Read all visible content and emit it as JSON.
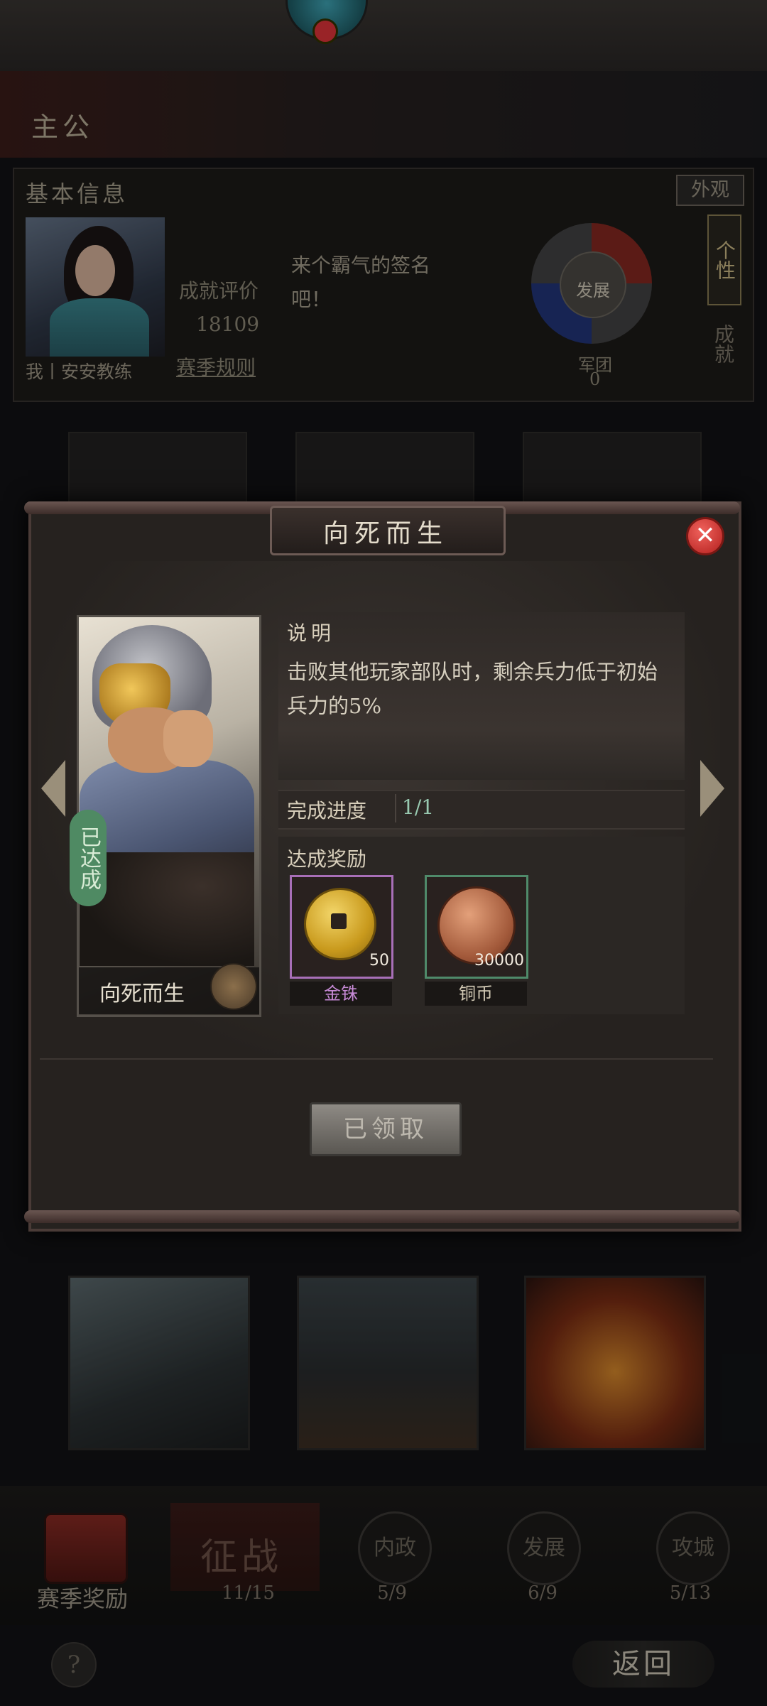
{
  "background": {
    "header_title": "主公",
    "basic_info": {
      "title": "基本信息",
      "appearance_button": "外观",
      "lord_name": "我丨安安教练",
      "achievement_score_label": "成就评价",
      "achievement_score": "18109",
      "season_rules": "赛季规则",
      "intro_text": "来个霸气的签名吧！",
      "development_label": "发展",
      "military_label": "军团",
      "military_value": "0",
      "tab_personality": "个性",
      "tab_achievement": "成就"
    },
    "bottom_nav": {
      "season_rewards": "赛季奖励",
      "campaign": "征战",
      "campaign_progress": "11/15",
      "domestic": "内政",
      "domestic_progress": "5/9",
      "development": "发展",
      "development_progress": "6/9",
      "siege": "攻城",
      "siege_progress": "5/13",
      "help": "?",
      "back": "返回"
    }
  },
  "modal": {
    "title": "向死而生",
    "close_icon": "close-icon",
    "card": {
      "name": "向死而生",
      "status_badge": "已达成"
    },
    "description_label": "说明",
    "description_text": "击败其他玩家部队时，剩余兵力低于初始兵力的5%",
    "progress_label": "完成进度",
    "progress_value": "1/1",
    "rewards_label": "达成奖励",
    "rewards": [
      {
        "name": "金铢",
        "quantity": "50",
        "icon": "gold-coin-icon",
        "frame_color": "#a86fb8"
      },
      {
        "name": "铜币",
        "quantity": "30000",
        "icon": "copper-coin-icon",
        "frame_color": "#4f8a6a"
      }
    ],
    "claim_button": "已领取"
  }
}
